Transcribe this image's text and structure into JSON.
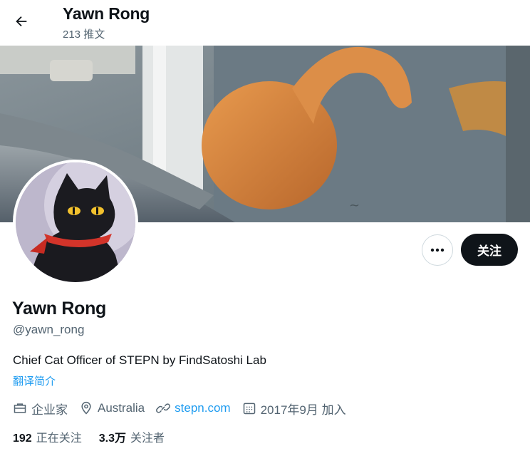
{
  "header": {
    "back_icon": "arrow-left-icon",
    "name": "Yawn Rong",
    "tweet_count": "213 推文"
  },
  "banner": {
    "description_colors": {
      "wall": "#6c7a82",
      "cat": "#d9843f",
      "pipe": "#8f9aa0"
    }
  },
  "avatar": {
    "icon": "black-cat-avatar"
  },
  "actions": {
    "more_icon": "more-dots-icon",
    "follow_label": "关注"
  },
  "profile": {
    "display_name": "Yawn Rong",
    "handle": "@yawn_rong",
    "bio": "Chief Cat Officer of STEPN by FindSatoshi Lab",
    "translate_label": "翻译简介",
    "meta": {
      "category": "企业家",
      "location": "Australia",
      "website": "stepn.com",
      "joined": "2017年9月 加入"
    },
    "stats": {
      "following_count": "192",
      "following_label": "正在关注",
      "followers_count": "3.3万",
      "followers_label": "关注者"
    }
  },
  "colors": {
    "accent": "#1d9bf0",
    "text": "#0f1419",
    "muted": "#536471",
    "button_dark": "#0f1419"
  }
}
